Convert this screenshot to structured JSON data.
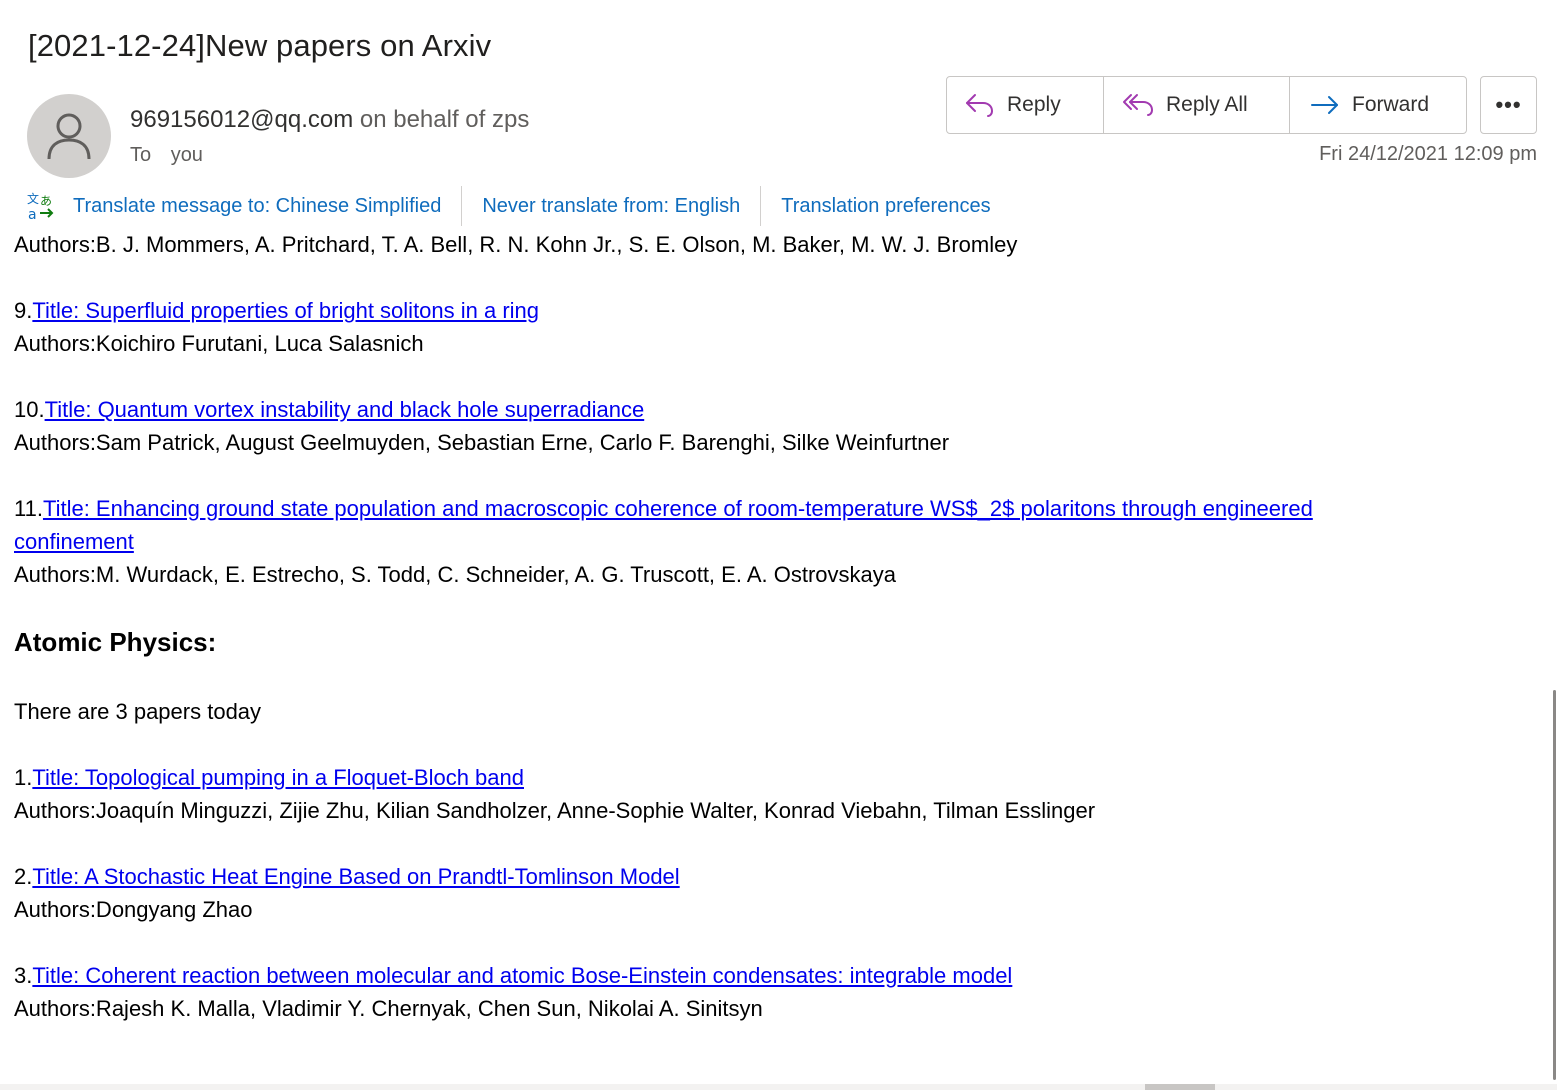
{
  "email": {
    "subject": "[2021-12-24]New papers on Arxiv",
    "sender_email": "969156012@qq.com",
    "sender_behalf": "on behalf of zps",
    "to_label": "To",
    "to_value": "you",
    "timestamp": "Fri 24/12/2021 12:09 pm"
  },
  "actions": {
    "reply": "Reply",
    "reply_all": "Reply All",
    "forward": "Forward",
    "more": "•••"
  },
  "translation": {
    "translate_to": "Translate message to: Chinese Simplified",
    "never_translate": "Never translate from: English",
    "preferences": "Translation preferences"
  },
  "body": {
    "top_authors": "Authors:B. J. Mommers, A. Pritchard, T. A. Bell, R. N. Kohn Jr., S. E. Olson, M. Baker, M. W. J. Bromley",
    "papers_a": [
      {
        "num": "9.",
        "title": "Title: Superfluid properties of bright solitons in a ring",
        "authors": "Authors:Koichiro Furutani, Luca Salasnich"
      },
      {
        "num": "10.",
        "title": "Title: Quantum vortex instability and black hole superradiance",
        "authors": "Authors:Sam Patrick, August Geelmuyden, Sebastian Erne, Carlo F. Barenghi, Silke Weinfurtner"
      },
      {
        "num": "11.",
        "title": "Title: Enhancing ground state population and macroscopic coherence of room-temperature WS$_2$ polaritons through engineered confinement",
        "authors": "Authors:M. Wurdack, E. Estrecho, S. Todd, C. Schneider, A. G. Truscott, E. A. Ostrovskaya"
      }
    ],
    "section_heading": "Atomic Physics:",
    "section_count": "There are 3 papers today",
    "papers_b": [
      {
        "num": "1.",
        "title": "Title: Topological pumping in a Floquet-Bloch band",
        "authors": "Authors:Joaquín Minguzzi, Zijie Zhu, Kilian Sandholzer, Anne-Sophie Walter, Konrad Viebahn, Tilman Esslinger"
      },
      {
        "num": "2.",
        "title": "Title: A Stochastic Heat Engine Based on Prandtl-Tomlinson Model",
        "authors": "Authors:Dongyang Zhao"
      },
      {
        "num": "3.",
        "title": "Title: Coherent reaction between molecular and atomic Bose-Einstein condensates: integrable model",
        "authors": "Authors:Rajesh K. Malla, Vladimir Y. Chernyak, Chen Sun, Nikolai A. Sinitsyn"
      }
    ]
  },
  "icons": {
    "avatar": "person-icon",
    "reply": "reply-arrow-icon",
    "reply_all": "reply-all-arrow-icon",
    "forward": "forward-arrow-icon",
    "translate": "translate-icon"
  },
  "colors": {
    "link": "#0000ee",
    "translate_link": "#0f6cbd",
    "reply_accent": "#a23ab0",
    "forward_accent": "#0f6cbd"
  }
}
